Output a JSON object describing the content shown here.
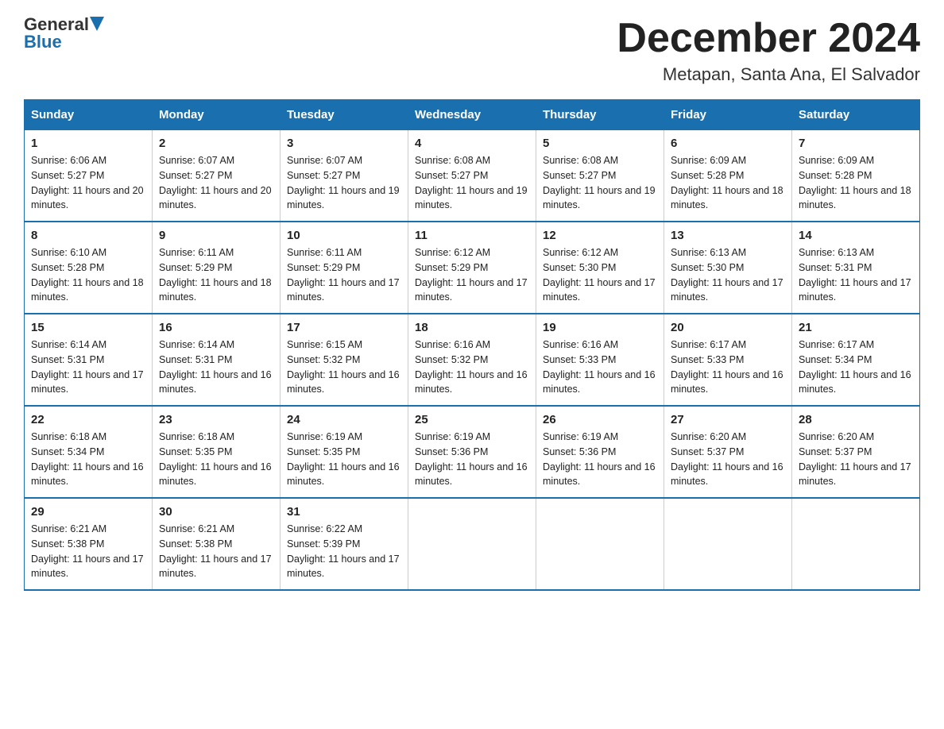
{
  "logo": {
    "general": "General",
    "blue": "Blue"
  },
  "header": {
    "month": "December 2024",
    "location": "Metapan, Santa Ana, El Salvador"
  },
  "days_of_week": [
    "Sunday",
    "Monday",
    "Tuesday",
    "Wednesday",
    "Thursday",
    "Friday",
    "Saturday"
  ],
  "weeks": [
    [
      {
        "day": "1",
        "sunrise": "6:06 AM",
        "sunset": "5:27 PM",
        "daylight": "11 hours and 20 minutes."
      },
      {
        "day": "2",
        "sunrise": "6:07 AM",
        "sunset": "5:27 PM",
        "daylight": "11 hours and 20 minutes."
      },
      {
        "day": "3",
        "sunrise": "6:07 AM",
        "sunset": "5:27 PM",
        "daylight": "11 hours and 19 minutes."
      },
      {
        "day": "4",
        "sunrise": "6:08 AM",
        "sunset": "5:27 PM",
        "daylight": "11 hours and 19 minutes."
      },
      {
        "day": "5",
        "sunrise": "6:08 AM",
        "sunset": "5:27 PM",
        "daylight": "11 hours and 19 minutes."
      },
      {
        "day": "6",
        "sunrise": "6:09 AM",
        "sunset": "5:28 PM",
        "daylight": "11 hours and 18 minutes."
      },
      {
        "day": "7",
        "sunrise": "6:09 AM",
        "sunset": "5:28 PM",
        "daylight": "11 hours and 18 minutes."
      }
    ],
    [
      {
        "day": "8",
        "sunrise": "6:10 AM",
        "sunset": "5:28 PM",
        "daylight": "11 hours and 18 minutes."
      },
      {
        "day": "9",
        "sunrise": "6:11 AM",
        "sunset": "5:29 PM",
        "daylight": "11 hours and 18 minutes."
      },
      {
        "day": "10",
        "sunrise": "6:11 AM",
        "sunset": "5:29 PM",
        "daylight": "11 hours and 17 minutes."
      },
      {
        "day": "11",
        "sunrise": "6:12 AM",
        "sunset": "5:29 PM",
        "daylight": "11 hours and 17 minutes."
      },
      {
        "day": "12",
        "sunrise": "6:12 AM",
        "sunset": "5:30 PM",
        "daylight": "11 hours and 17 minutes."
      },
      {
        "day": "13",
        "sunrise": "6:13 AM",
        "sunset": "5:30 PM",
        "daylight": "11 hours and 17 minutes."
      },
      {
        "day": "14",
        "sunrise": "6:13 AM",
        "sunset": "5:31 PM",
        "daylight": "11 hours and 17 minutes."
      }
    ],
    [
      {
        "day": "15",
        "sunrise": "6:14 AM",
        "sunset": "5:31 PM",
        "daylight": "11 hours and 17 minutes."
      },
      {
        "day": "16",
        "sunrise": "6:14 AM",
        "sunset": "5:31 PM",
        "daylight": "11 hours and 16 minutes."
      },
      {
        "day": "17",
        "sunrise": "6:15 AM",
        "sunset": "5:32 PM",
        "daylight": "11 hours and 16 minutes."
      },
      {
        "day": "18",
        "sunrise": "6:16 AM",
        "sunset": "5:32 PM",
        "daylight": "11 hours and 16 minutes."
      },
      {
        "day": "19",
        "sunrise": "6:16 AM",
        "sunset": "5:33 PM",
        "daylight": "11 hours and 16 minutes."
      },
      {
        "day": "20",
        "sunrise": "6:17 AM",
        "sunset": "5:33 PM",
        "daylight": "11 hours and 16 minutes."
      },
      {
        "day": "21",
        "sunrise": "6:17 AM",
        "sunset": "5:34 PM",
        "daylight": "11 hours and 16 minutes."
      }
    ],
    [
      {
        "day": "22",
        "sunrise": "6:18 AM",
        "sunset": "5:34 PM",
        "daylight": "11 hours and 16 minutes."
      },
      {
        "day": "23",
        "sunrise": "6:18 AM",
        "sunset": "5:35 PM",
        "daylight": "11 hours and 16 minutes."
      },
      {
        "day": "24",
        "sunrise": "6:19 AM",
        "sunset": "5:35 PM",
        "daylight": "11 hours and 16 minutes."
      },
      {
        "day": "25",
        "sunrise": "6:19 AM",
        "sunset": "5:36 PM",
        "daylight": "11 hours and 16 minutes."
      },
      {
        "day": "26",
        "sunrise": "6:19 AM",
        "sunset": "5:36 PM",
        "daylight": "11 hours and 16 minutes."
      },
      {
        "day": "27",
        "sunrise": "6:20 AM",
        "sunset": "5:37 PM",
        "daylight": "11 hours and 16 minutes."
      },
      {
        "day": "28",
        "sunrise": "6:20 AM",
        "sunset": "5:37 PM",
        "daylight": "11 hours and 17 minutes."
      }
    ],
    [
      {
        "day": "29",
        "sunrise": "6:21 AM",
        "sunset": "5:38 PM",
        "daylight": "11 hours and 17 minutes."
      },
      {
        "day": "30",
        "sunrise": "6:21 AM",
        "sunset": "5:38 PM",
        "daylight": "11 hours and 17 minutes."
      },
      {
        "day": "31",
        "sunrise": "6:22 AM",
        "sunset": "5:39 PM",
        "daylight": "11 hours and 17 minutes."
      },
      null,
      null,
      null,
      null
    ]
  ],
  "labels": {
    "sunrise": "Sunrise:",
    "sunset": "Sunset:",
    "daylight": "Daylight:"
  }
}
